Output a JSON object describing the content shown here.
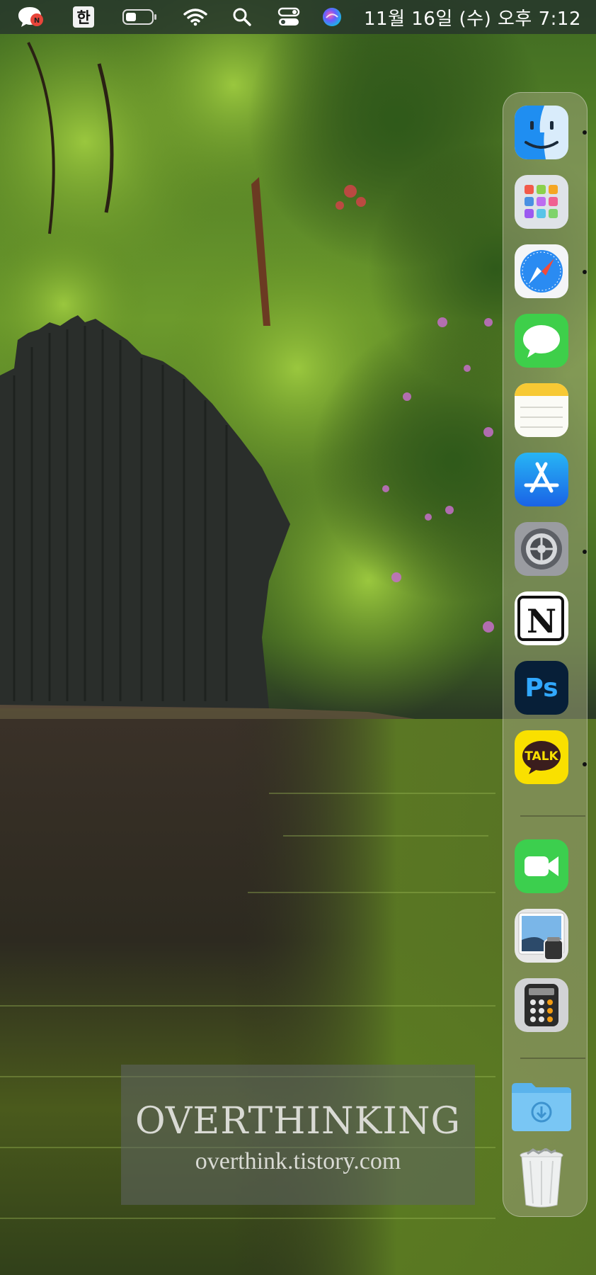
{
  "menubar": {
    "app_icon": "naver-talk-bubble-icon",
    "input_method": "한",
    "battery_icon": "battery-icon",
    "wifi_icon": "wifi-icon",
    "spotlight_icon": "search-icon",
    "control_center_icon": "control-center-icon",
    "siri_icon": "siri-icon",
    "clock": "11월 16일 (수) 오후  7:12"
  },
  "dock": {
    "items": [
      {
        "name": "Finder",
        "icon": "finder-icon",
        "running": true
      },
      {
        "name": "Launchpad",
        "icon": "launchpad-icon",
        "running": false
      },
      {
        "name": "Safari",
        "icon": "safari-icon",
        "running": true
      },
      {
        "name": "Messages",
        "icon": "messages-icon",
        "running": false
      },
      {
        "name": "Notes",
        "icon": "notes-icon",
        "running": false
      },
      {
        "name": "App Store",
        "icon": "app-store-icon",
        "running": false
      },
      {
        "name": "System Preferences",
        "icon": "system-preferences-icon",
        "running": true
      },
      {
        "name": "Notion",
        "icon": "notion-icon",
        "running": false
      },
      {
        "name": "Photoshop",
        "icon": "photoshop-icon",
        "running": false,
        "label": "Ps"
      },
      {
        "name": "KakaoTalk",
        "icon": "kakaotalk-icon",
        "running": true,
        "label": "TALK"
      },
      {
        "name": "FaceTime",
        "icon": "facetime-icon",
        "running": false
      },
      {
        "name": "Preview",
        "icon": "preview-icon",
        "running": false
      },
      {
        "name": "Calculator",
        "icon": "calculator-icon",
        "running": false
      },
      {
        "name": "Downloads",
        "icon": "downloads-folder-icon",
        "running": false
      },
      {
        "name": "Trash",
        "icon": "trash-icon",
        "running": false
      }
    ]
  },
  "watermark": {
    "title": "OVERTHINKING",
    "subtitle": "overthink.tistory.com"
  }
}
